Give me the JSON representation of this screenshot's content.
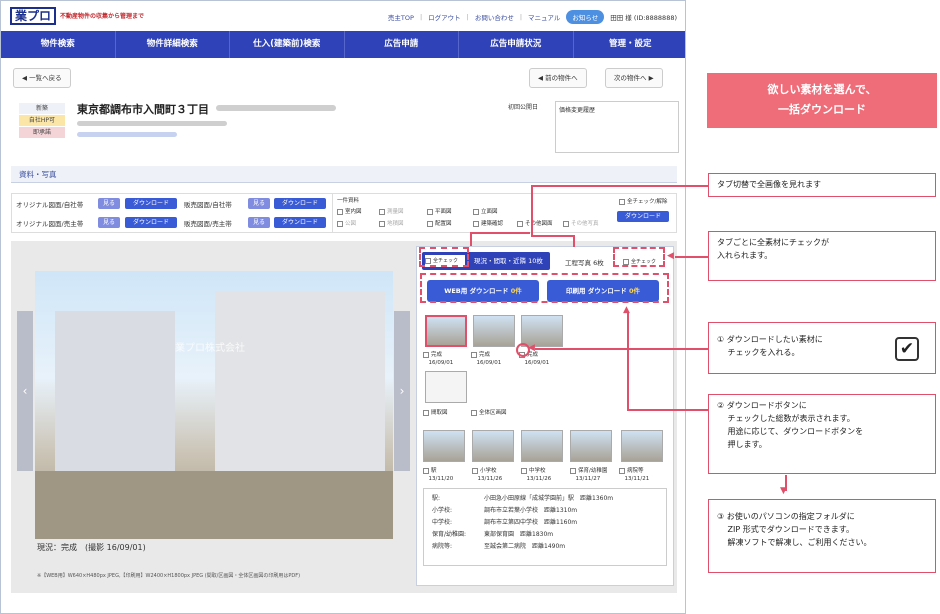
{
  "header": {
    "logo": "業プロ",
    "tagline": "不動産物件の収集から管理まで",
    "links": [
      "売主TOP",
      "ログアウト",
      "お問い合わせ",
      "マニュアル"
    ],
    "notice": "お知らせ",
    "user": "田田 様 (ID:8888888)"
  },
  "nav": [
    "物件検索",
    "物件詳細検索",
    "仕入(建築前)検索",
    "広告申請",
    "広告申請状況",
    "管理・設定"
  ],
  "toolbar": {
    "back": "一覧へ戻る",
    "prev": "前の物件へ",
    "next": "次の物件へ"
  },
  "property": {
    "title": "東京都調布市入間町３丁目",
    "tags": [
      "新築",
      "自社HP可",
      "即承諾"
    ],
    "first_date_label": "初回公開日",
    "history_label": "価格変更履歴"
  },
  "section": {
    "title": "資料・写真"
  },
  "downloads": {
    "row1a": "オリジナル図面/自社帯",
    "row1b": "販売図面/自社帯",
    "row2a": "オリジナル図面/売主帯",
    "row2b": "販売図面/売主帯",
    "view": "見る",
    "download": "ダウンロード",
    "ikkatsu": "一件資料",
    "items": [
      "室内図",
      "測量図",
      "平面図",
      "立面図",
      "建築確認",
      "その他図面",
      "公図",
      "地積図",
      "配置図",
      "建築確認",
      "その他図面",
      "その他写真"
    ],
    "check_all": "全チェック/解除",
    "dl": "ダウンロード"
  },
  "gallery": {
    "watermark": "業プロ株式会社",
    "caption": "現況：完成　(撮影 16/09/01)",
    "note": "※【WEB用】W640×H480px JPEG,【印刷用】W2400×H1800px JPEG (間取/区画図・全体区画図の印刷用はPDF)"
  },
  "panel": {
    "tab1": "現況・間取・近隣 10枚",
    "tab2": "工程写真 6枚",
    "check": "全チェック",
    "web_dl": "WEB用 ダウンロード",
    "web_count": "0件",
    "print_dl": "印刷用 ダウンロード",
    "print_count": "0件",
    "row1": [
      {
        "label": "完成",
        "date": "16/09/01"
      },
      {
        "label": "完成",
        "date": "16/09/01"
      },
      {
        "label": "完成",
        "date": "16/09/01"
      }
    ],
    "row2": [
      {
        "label": "間取図",
        "date": ""
      },
      {
        "label": "全体区画図",
        "date": ""
      }
    ],
    "row3": [
      {
        "label": "駅",
        "date": "13/11/20"
      },
      {
        "label": "小学校",
        "date": "13/11/26"
      },
      {
        "label": "中学校",
        "date": "13/11/26"
      },
      {
        "label": "保育/幼稚園",
        "date": "13/11/27"
      },
      {
        "label": "病院等",
        "date": "13/11/21"
      }
    ],
    "info": [
      [
        "駅:",
        "小田急小田原線「成城学園前」駅　距離1360m"
      ],
      [
        "小学校:",
        "調布市立若葉小学校　距離1310m"
      ],
      [
        "中学校:",
        "調布市立第四中学校　距離1160m"
      ],
      [
        "保育/幼稚園:",
        "東部保育園　距離1830m"
      ],
      [
        "病院等:",
        "至誠会第二病院　距離1490m"
      ]
    ]
  },
  "callouts": {
    "banner": [
      "欲しい素材を選んで、",
      "一括ダウンロード"
    ],
    "c1": "タブ切替で全画像を見れます",
    "c2": [
      "タブごとに全素材にチェックが",
      "入れられます。"
    ],
    "c3": [
      "① ダウンロードしたい素材に",
      "　 チェックを入れる。"
    ],
    "c4": [
      "② ダウンロードボタンに",
      "　 チェックした総数が表示されます。",
      "　 用途に応じて、ダウンロードボタンを",
      "　 押します。"
    ],
    "c5": [
      "③ お使いのパソコンの指定フォルダに",
      "　 ZIP 形式でダウンロードできます。",
      "　 解凍ソフトで解凍し、ご利用ください。"
    ]
  },
  "colors": {
    "nav": "#2f42b8",
    "accent": "#e0506a",
    "button": "#3a5bd6"
  }
}
